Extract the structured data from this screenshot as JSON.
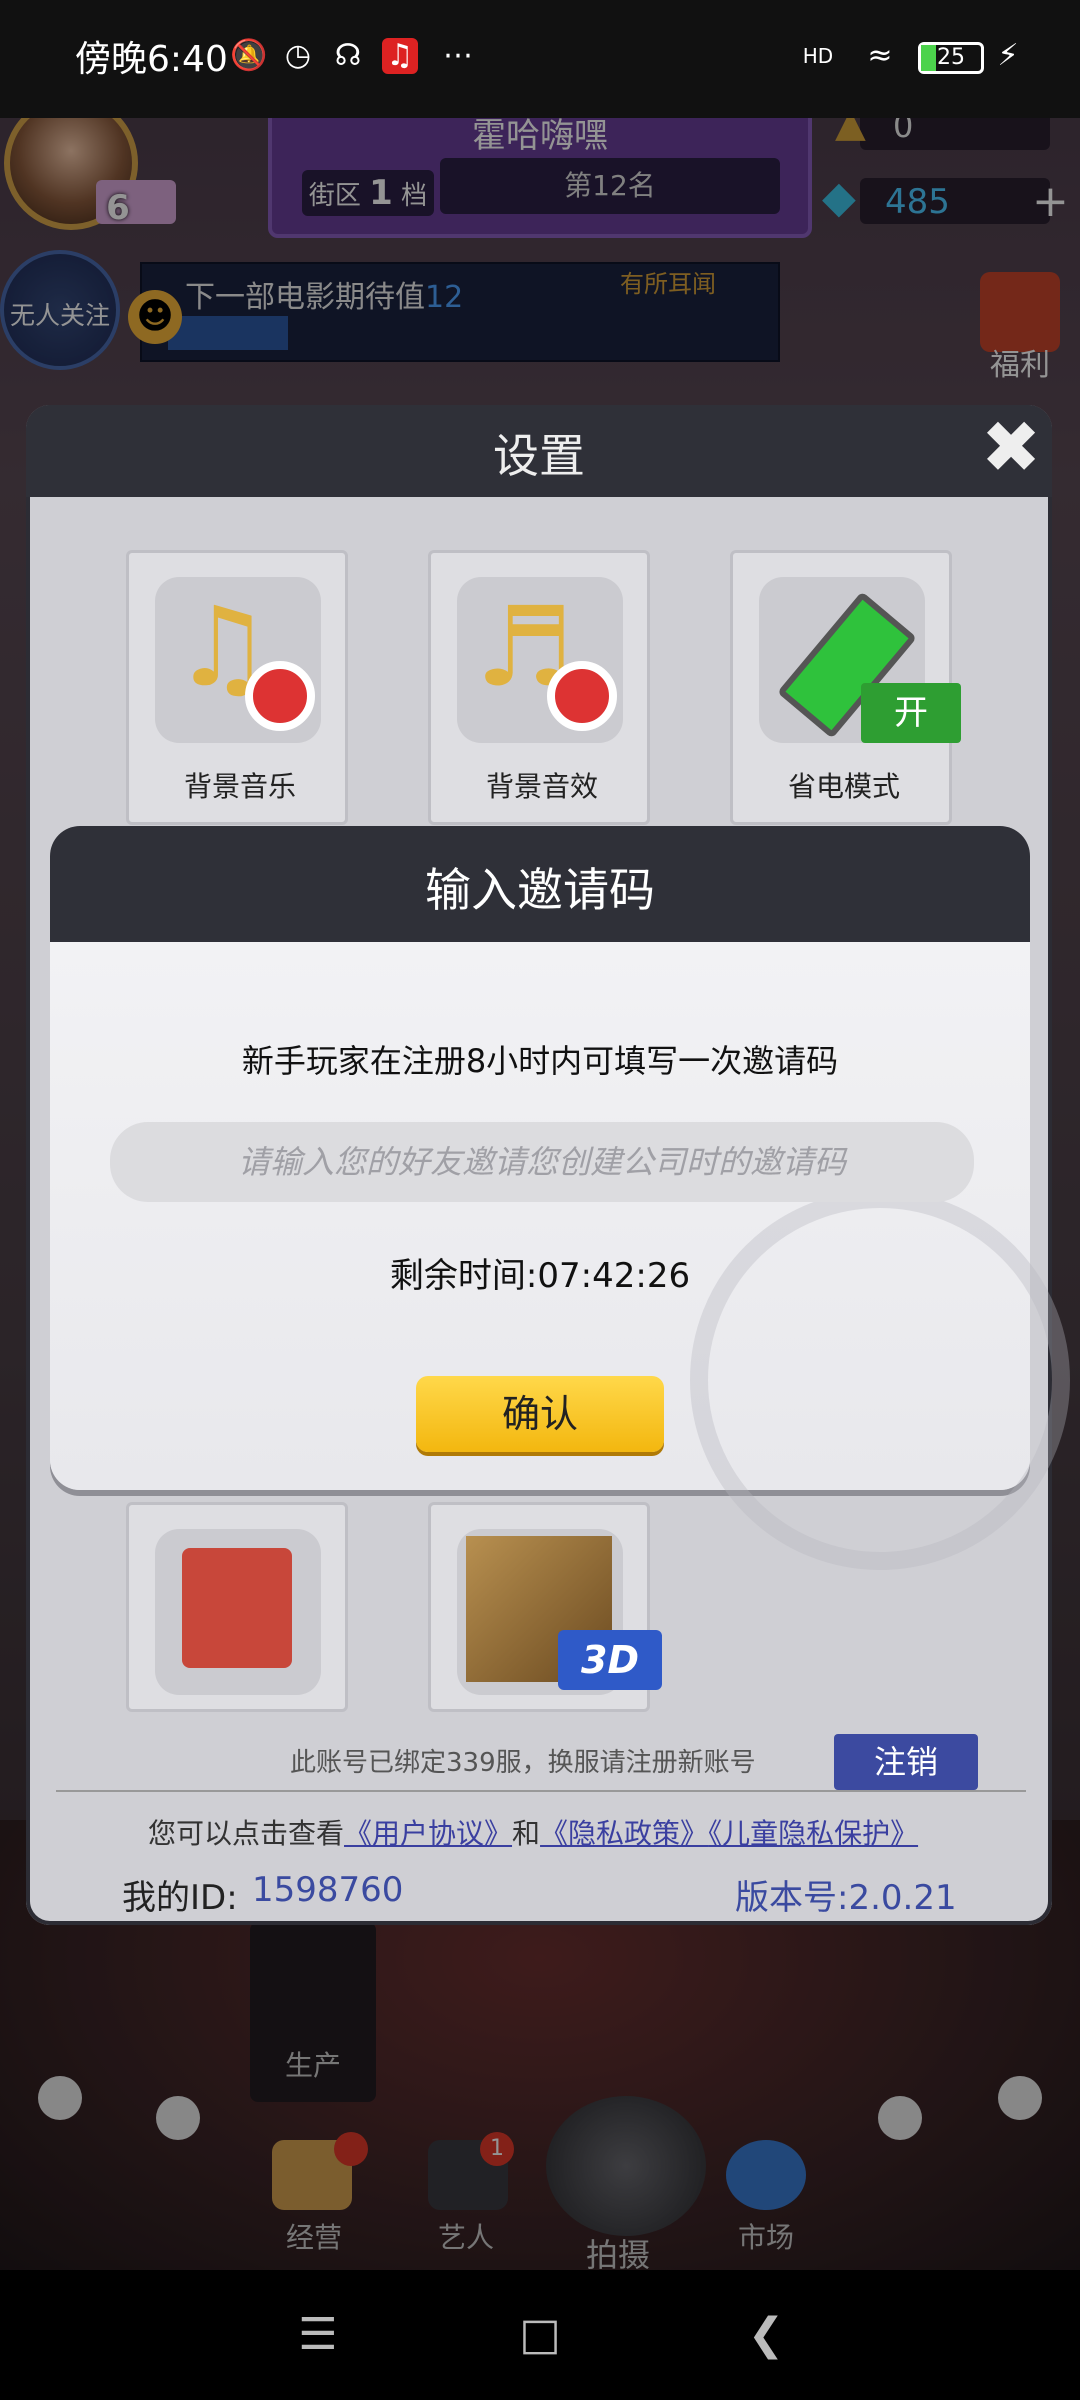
{
  "status_bar": {
    "time": "傍晚6:40",
    "icons": [
      "mute-bell-icon",
      "alarm-icon",
      "headphones-icon",
      "netease-music-icon",
      "more-dots-icon"
    ],
    "signal": "HD",
    "battery": "25"
  },
  "hud": {
    "level": "6",
    "company_name": "霍哈嗨嘿",
    "district_label": "街区",
    "district_num": "1",
    "district_unit": "档",
    "rank": "第12名",
    "coins": "0",
    "diamonds": "485",
    "follow_label": "无人关注",
    "expect_label": "下一部电影期待值",
    "expect_value": "12",
    "rumor": "有所耳闻",
    "gift_label": "福利"
  },
  "settings": {
    "title": "设置",
    "tiles": [
      {
        "label": "背景音乐",
        "icon": "music-note-muted-icon"
      },
      {
        "label": "背景音效",
        "icon": "sound-effect-muted-icon"
      },
      {
        "label": "省电模式",
        "icon": "battery-icon",
        "badge": "开"
      }
    ],
    "bind_text": "此账号已绑定339服，换服请注册新账号",
    "logout": "注销",
    "agree_prefix": "您可以点击查看",
    "user_agreement": "《用户协议》",
    "and": "和",
    "privacy": "《隐私政策》",
    "child_privacy": "《儿童隐私保护》",
    "myid_label": "我的ID:",
    "myid_value": "1598760",
    "version": "版本号:2.0.21",
    "badge_3d": "3D"
  },
  "invite": {
    "title": "输入邀请码",
    "description": "新手玩家在注册8小时内可填写一次邀请码",
    "placeholder": "请输入您的好友邀请您创建公司时的邀请码",
    "remaining": "剩余时间:07:42:26",
    "confirm": "确认"
  },
  "bottom_nav": {
    "produce": "生产",
    "items": [
      {
        "label": "经营"
      },
      {
        "label": "艺人",
        "badge": "1"
      },
      {
        "label": "拍摄"
      },
      {
        "label": "市场"
      }
    ]
  }
}
